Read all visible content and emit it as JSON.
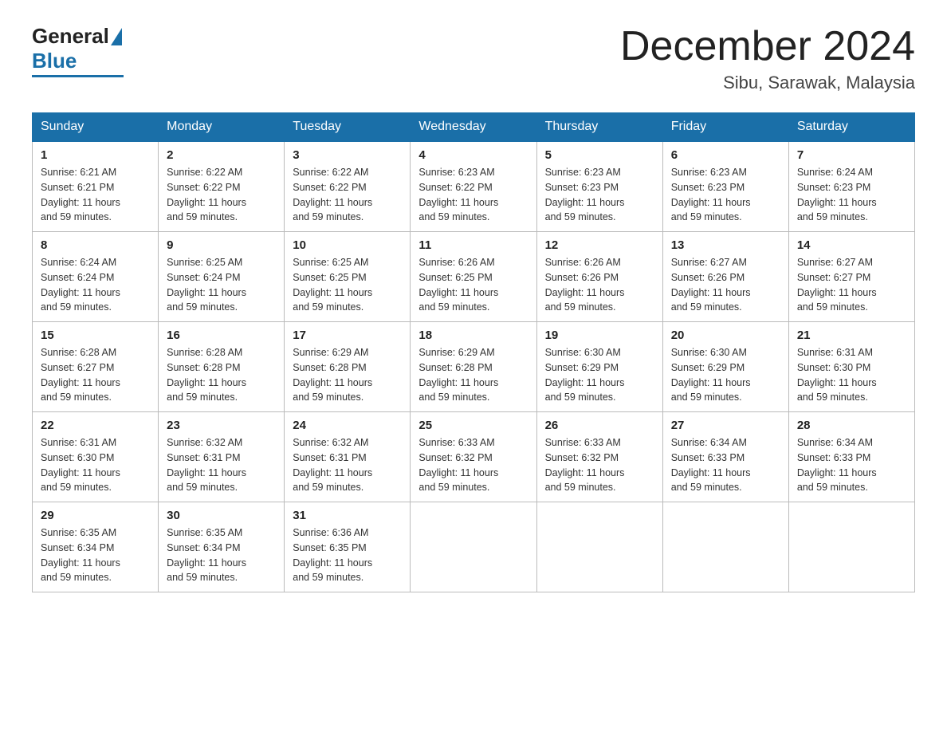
{
  "logo": {
    "general": "General",
    "blue": "Blue"
  },
  "title": "December 2024",
  "location": "Sibu, Sarawak, Malaysia",
  "days_of_week": [
    "Sunday",
    "Monday",
    "Tuesday",
    "Wednesday",
    "Thursday",
    "Friday",
    "Saturday"
  ],
  "weeks": [
    [
      {
        "day": "1",
        "sunrise": "6:21 AM",
        "sunset": "6:21 PM",
        "daylight": "11 hours and 59 minutes."
      },
      {
        "day": "2",
        "sunrise": "6:22 AM",
        "sunset": "6:22 PM",
        "daylight": "11 hours and 59 minutes."
      },
      {
        "day": "3",
        "sunrise": "6:22 AM",
        "sunset": "6:22 PM",
        "daylight": "11 hours and 59 minutes."
      },
      {
        "day": "4",
        "sunrise": "6:23 AM",
        "sunset": "6:22 PM",
        "daylight": "11 hours and 59 minutes."
      },
      {
        "day": "5",
        "sunrise": "6:23 AM",
        "sunset": "6:23 PM",
        "daylight": "11 hours and 59 minutes."
      },
      {
        "day": "6",
        "sunrise": "6:23 AM",
        "sunset": "6:23 PM",
        "daylight": "11 hours and 59 minutes."
      },
      {
        "day": "7",
        "sunrise": "6:24 AM",
        "sunset": "6:23 PM",
        "daylight": "11 hours and 59 minutes."
      }
    ],
    [
      {
        "day": "8",
        "sunrise": "6:24 AM",
        "sunset": "6:24 PM",
        "daylight": "11 hours and 59 minutes."
      },
      {
        "day": "9",
        "sunrise": "6:25 AM",
        "sunset": "6:24 PM",
        "daylight": "11 hours and 59 minutes."
      },
      {
        "day": "10",
        "sunrise": "6:25 AM",
        "sunset": "6:25 PM",
        "daylight": "11 hours and 59 minutes."
      },
      {
        "day": "11",
        "sunrise": "6:26 AM",
        "sunset": "6:25 PM",
        "daylight": "11 hours and 59 minutes."
      },
      {
        "day": "12",
        "sunrise": "6:26 AM",
        "sunset": "6:26 PM",
        "daylight": "11 hours and 59 minutes."
      },
      {
        "day": "13",
        "sunrise": "6:27 AM",
        "sunset": "6:26 PM",
        "daylight": "11 hours and 59 minutes."
      },
      {
        "day": "14",
        "sunrise": "6:27 AM",
        "sunset": "6:27 PM",
        "daylight": "11 hours and 59 minutes."
      }
    ],
    [
      {
        "day": "15",
        "sunrise": "6:28 AM",
        "sunset": "6:27 PM",
        "daylight": "11 hours and 59 minutes."
      },
      {
        "day": "16",
        "sunrise": "6:28 AM",
        "sunset": "6:28 PM",
        "daylight": "11 hours and 59 minutes."
      },
      {
        "day": "17",
        "sunrise": "6:29 AM",
        "sunset": "6:28 PM",
        "daylight": "11 hours and 59 minutes."
      },
      {
        "day": "18",
        "sunrise": "6:29 AM",
        "sunset": "6:28 PM",
        "daylight": "11 hours and 59 minutes."
      },
      {
        "day": "19",
        "sunrise": "6:30 AM",
        "sunset": "6:29 PM",
        "daylight": "11 hours and 59 minutes."
      },
      {
        "day": "20",
        "sunrise": "6:30 AM",
        "sunset": "6:29 PM",
        "daylight": "11 hours and 59 minutes."
      },
      {
        "day": "21",
        "sunrise": "6:31 AM",
        "sunset": "6:30 PM",
        "daylight": "11 hours and 59 minutes."
      }
    ],
    [
      {
        "day": "22",
        "sunrise": "6:31 AM",
        "sunset": "6:30 PM",
        "daylight": "11 hours and 59 minutes."
      },
      {
        "day": "23",
        "sunrise": "6:32 AM",
        "sunset": "6:31 PM",
        "daylight": "11 hours and 59 minutes."
      },
      {
        "day": "24",
        "sunrise": "6:32 AM",
        "sunset": "6:31 PM",
        "daylight": "11 hours and 59 minutes."
      },
      {
        "day": "25",
        "sunrise": "6:33 AM",
        "sunset": "6:32 PM",
        "daylight": "11 hours and 59 minutes."
      },
      {
        "day": "26",
        "sunrise": "6:33 AM",
        "sunset": "6:32 PM",
        "daylight": "11 hours and 59 minutes."
      },
      {
        "day": "27",
        "sunrise": "6:34 AM",
        "sunset": "6:33 PM",
        "daylight": "11 hours and 59 minutes."
      },
      {
        "day": "28",
        "sunrise": "6:34 AM",
        "sunset": "6:33 PM",
        "daylight": "11 hours and 59 minutes."
      }
    ],
    [
      {
        "day": "29",
        "sunrise": "6:35 AM",
        "sunset": "6:34 PM",
        "daylight": "11 hours and 59 minutes."
      },
      {
        "day": "30",
        "sunrise": "6:35 AM",
        "sunset": "6:34 PM",
        "daylight": "11 hours and 59 minutes."
      },
      {
        "day": "31",
        "sunrise": "6:36 AM",
        "sunset": "6:35 PM",
        "daylight": "11 hours and 59 minutes."
      },
      null,
      null,
      null,
      null
    ]
  ],
  "labels": {
    "sunrise": "Sunrise:",
    "sunset": "Sunset:",
    "daylight": "Daylight:"
  }
}
